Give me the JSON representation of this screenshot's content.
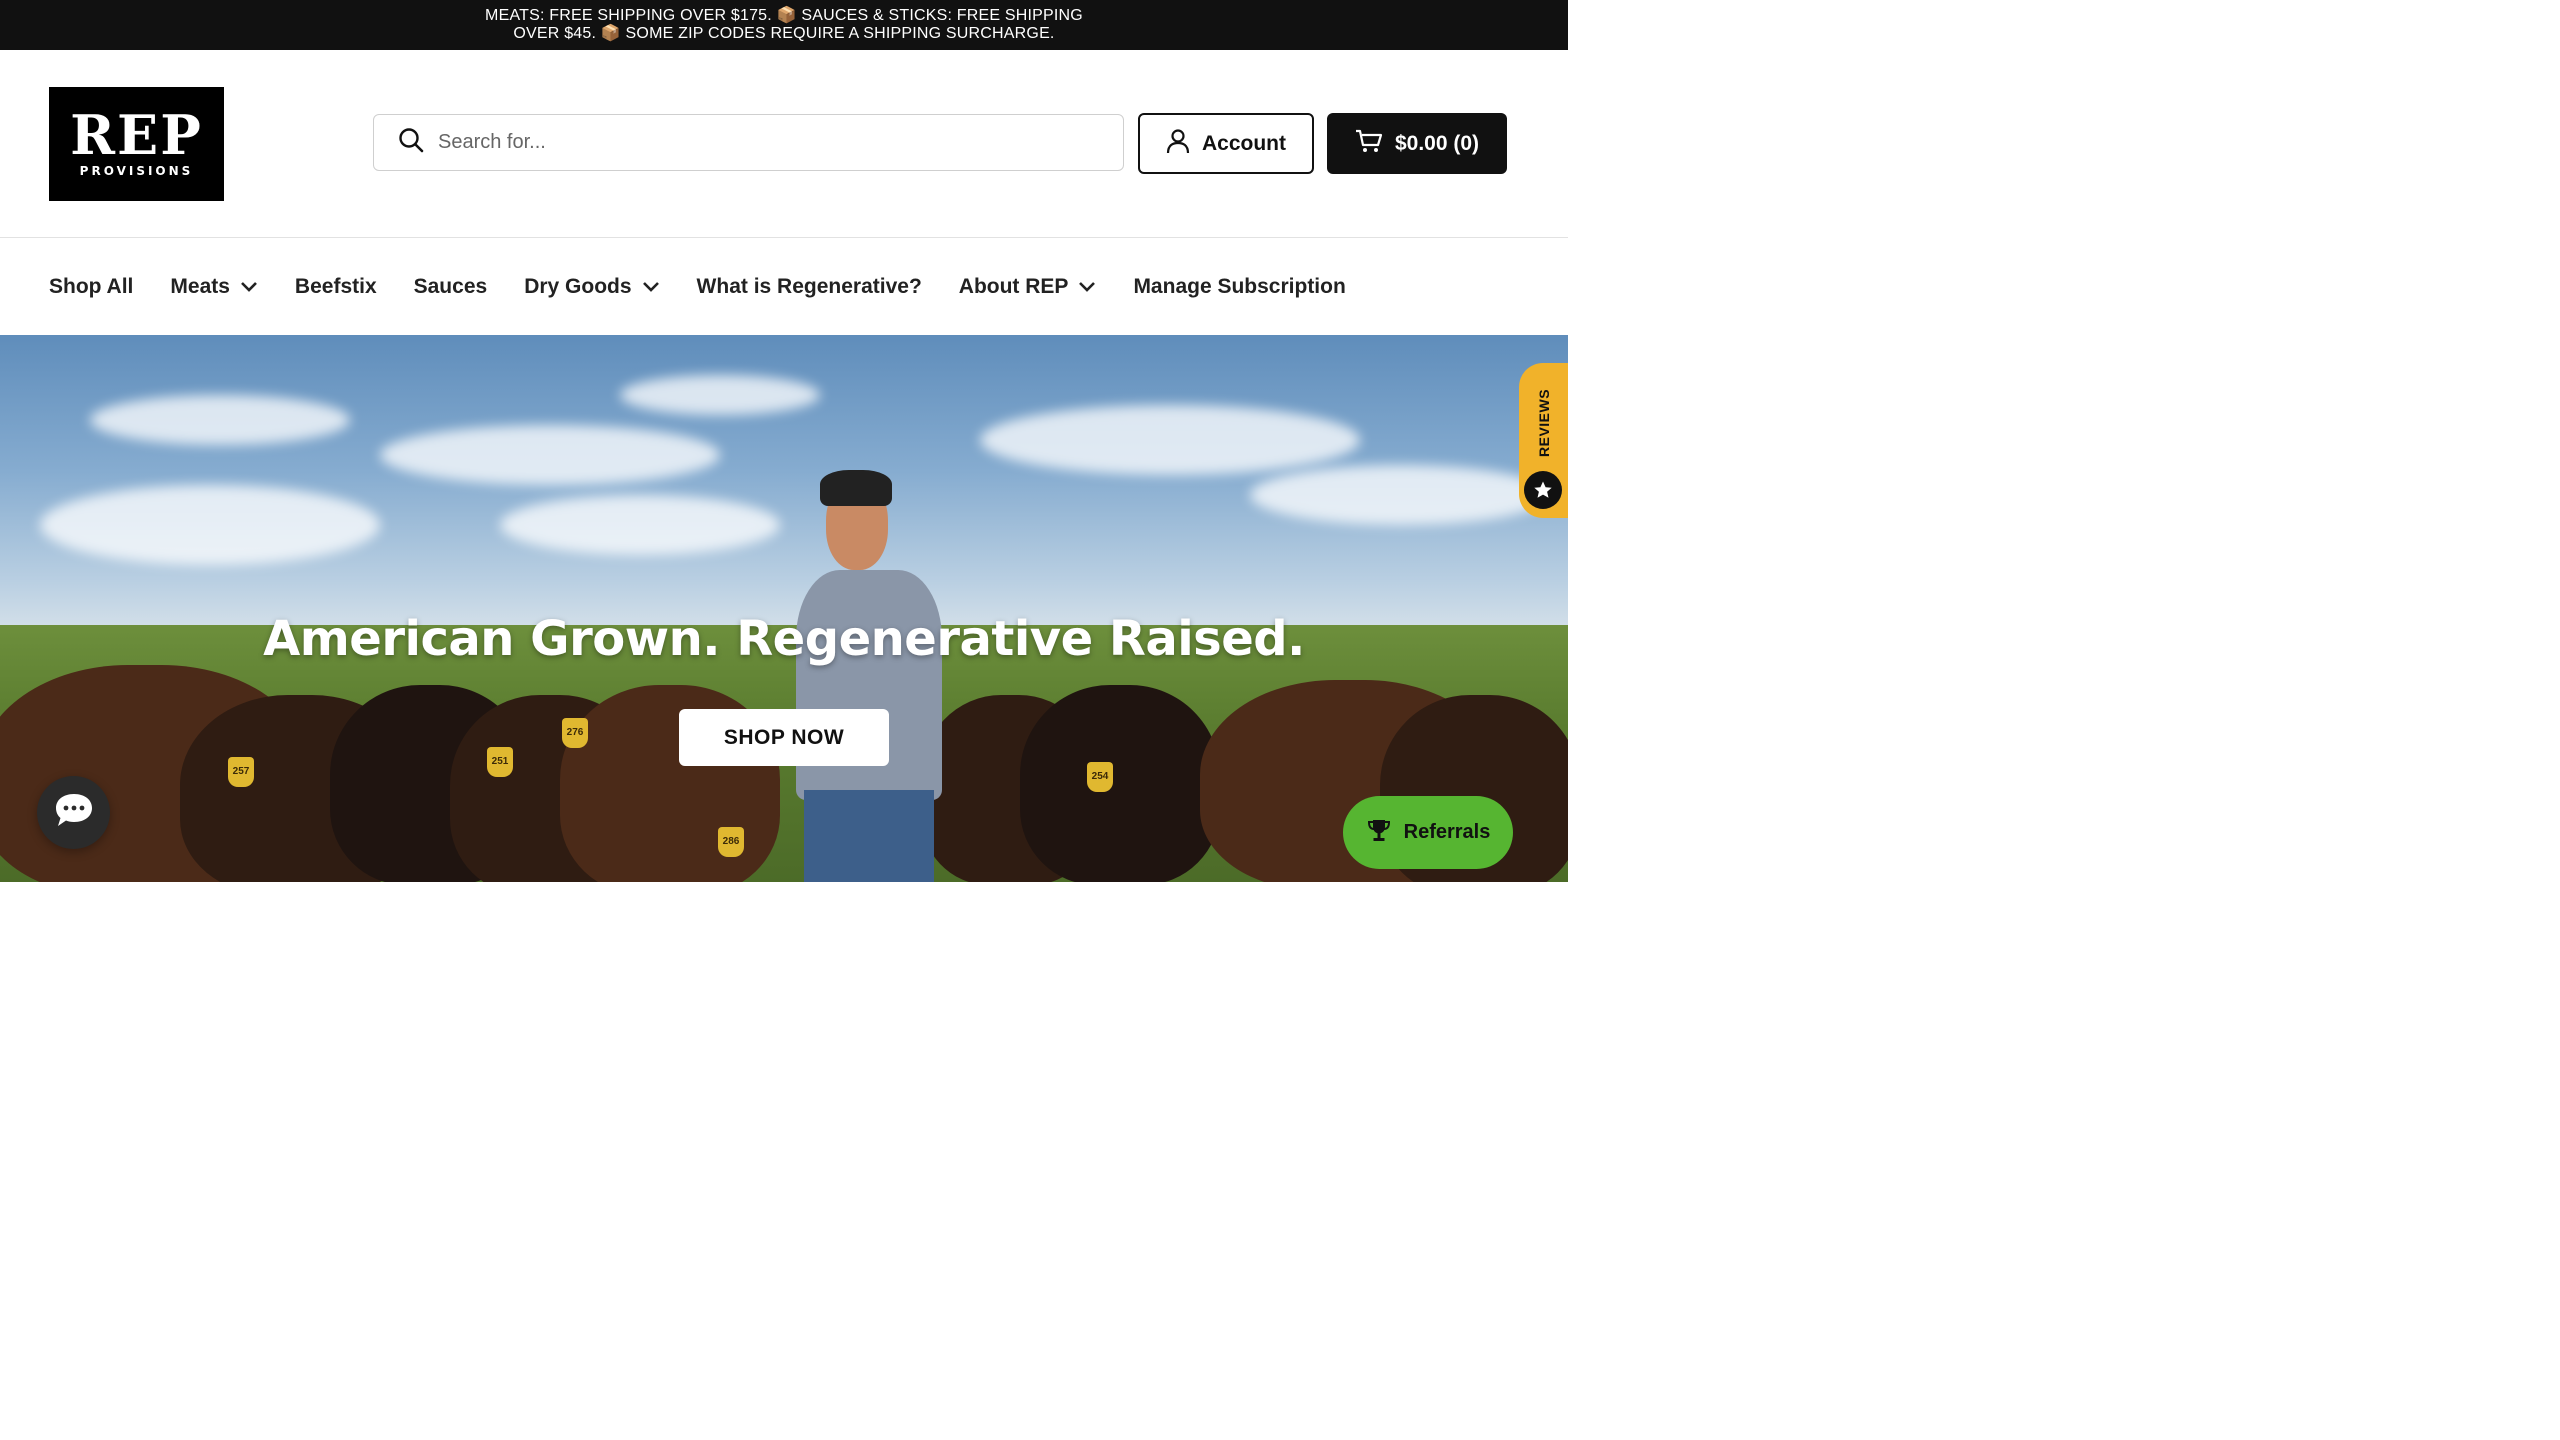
{
  "announcement": {
    "text": "MEATS: FREE SHIPPING OVER $175. 📦 SAUCES & STICKS: FREE SHIPPING OVER $45. 📦 SOME ZIP CODES REQUIRE A SHIPPING SURCHARGE."
  },
  "header": {
    "logo_mark": "REP",
    "logo_sub": "PROVISIONS",
    "search_placeholder": "Search for...",
    "account_label": "Account",
    "cart_label": "$0.00 (0)"
  },
  "nav": {
    "items": [
      {
        "label": "Shop All",
        "dropdown": false
      },
      {
        "label": "Meats",
        "dropdown": true
      },
      {
        "label": "Beefstix",
        "dropdown": false
      },
      {
        "label": "Sauces",
        "dropdown": false
      },
      {
        "label": "Dry Goods",
        "dropdown": true
      },
      {
        "label": "What is Regenerative?",
        "dropdown": false
      },
      {
        "label": "About REP",
        "dropdown": true
      },
      {
        "label": "Manage Subscription",
        "dropdown": false
      }
    ]
  },
  "hero": {
    "title": "American Grown. Regenerative Raised.",
    "cta_label": "SHOP NOW",
    "tag_numbers": [
      "257",
      "251",
      "276",
      "286",
      "254"
    ]
  },
  "widgets": {
    "reviews_label": "REVIEWS",
    "referrals_label": "Referrals"
  },
  "colors": {
    "topbar": "#111111",
    "cart_button": "#111111",
    "reviews_tab": "#f1b22a",
    "referrals_button": "#56b531"
  },
  "icons": {
    "search": "search-icon",
    "account": "user-icon",
    "cart": "cart-icon",
    "dropdown": "chevron-down-icon",
    "chat": "chat-bubble-icon",
    "referrals": "trophy-icon",
    "reviews": "star-icon"
  }
}
